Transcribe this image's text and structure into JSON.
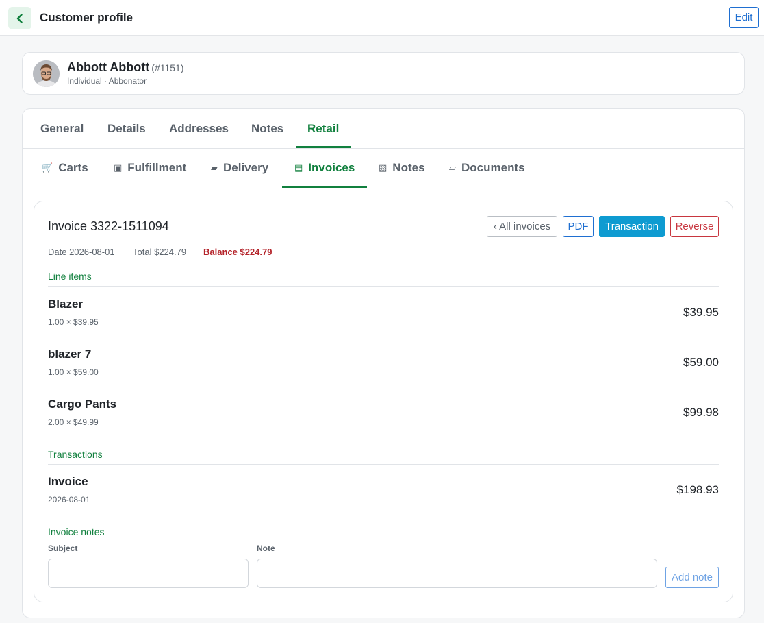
{
  "header": {
    "title": "Customer profile",
    "edit_label": "Edit",
    "back_icon": "chevron-left-icon"
  },
  "customer": {
    "name": "Abbott Abbott",
    "id": "(#1151)",
    "type": "Individual · Abbonator"
  },
  "tabs": [
    {
      "label": "General"
    },
    {
      "label": "Details"
    },
    {
      "label": "Addresses"
    },
    {
      "label": "Notes"
    },
    {
      "label": "Retail",
      "active": true
    }
  ],
  "subtabs": [
    {
      "label": "Carts",
      "icon": "🛒",
      "icon_name": "cart-icon"
    },
    {
      "label": "Fulfillment",
      "icon": "▣",
      "icon_name": "box-icon"
    },
    {
      "label": "Delivery",
      "icon": "▰",
      "icon_name": "truck-icon"
    },
    {
      "label": "Invoices",
      "icon": "▤",
      "icon_name": "invoice-icon",
      "active": true
    },
    {
      "label": "Notes",
      "icon": "▧",
      "icon_name": "notes-icon"
    },
    {
      "label": "Documents",
      "icon": "▱",
      "icon_name": "documents-icon"
    }
  ],
  "invoice": {
    "title": "Invoice 3322-1511094",
    "buttons": {
      "all": "‹ All invoices",
      "pdf": "PDF",
      "transaction": "Transaction",
      "reverse": "Reverse"
    },
    "date": "Date 2026-08-01",
    "total": "Total $224.79",
    "balance": "Balance $224.79",
    "line_items_heading": "Line items",
    "line_items": [
      {
        "name": "Blazer",
        "qty_price": "1.00 × $39.95",
        "amount": "$39.95"
      },
      {
        "name": "blazer 7",
        "qty_price": "1.00 × $59.00",
        "amount": "$59.00"
      },
      {
        "name": "Cargo Pants",
        "qty_price": "2.00 × $49.99",
        "amount": "$99.98"
      }
    ],
    "transactions_heading": "Transactions",
    "transactions": [
      {
        "name": "Invoice",
        "date": "2026-08-01",
        "amount": "$198.93"
      }
    ],
    "notes_heading": "Invoice notes",
    "subject_label": "Subject",
    "note_label": "Note",
    "subject_value": "",
    "note_value": "",
    "add_note_label": "Add note"
  },
  "colors": {
    "accent_green": "#11803e",
    "primary_blue": "#1f6fd1",
    "transaction_blue": "#0e9bd1",
    "danger_red": "#c8363f"
  }
}
